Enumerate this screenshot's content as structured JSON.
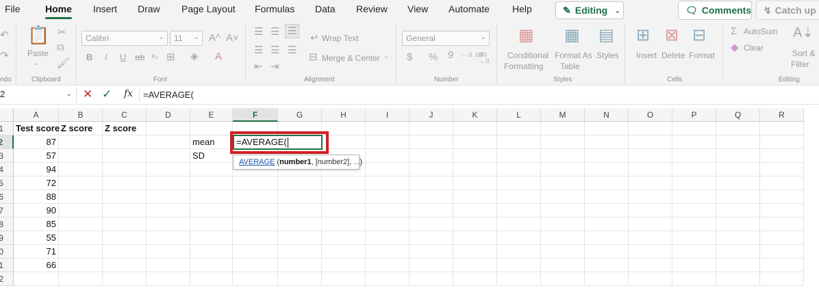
{
  "menu": {
    "tabs": [
      "File",
      "Home",
      "Insert",
      "Draw",
      "Page Layout",
      "Formulas",
      "Data",
      "Review",
      "View",
      "Automate",
      "Help"
    ],
    "active": "Home",
    "editing_label": "Editing",
    "comments_label": "Comments",
    "catchup_label": "Catch up"
  },
  "ribbon": {
    "undo_group": "ndo",
    "clipboard": {
      "paste": "Paste",
      "group": "Clipboard"
    },
    "font": {
      "name": "Calibri",
      "size": "11",
      "group": "Font",
      "grow": "A^",
      "shrink": "A˅",
      "bold": "B",
      "italic": "I",
      "underline": "U",
      "strike": "ab"
    },
    "alignment": {
      "wrap": "Wrap Text",
      "merge": "Merge & Center",
      "group": "Alignment"
    },
    "number": {
      "format": "General",
      "currency": "$",
      "percent": "%",
      "comma": "9",
      "inc_decimal": "←.0 .00",
      "dec_decimal": ".00 →.0",
      "group": "Number"
    },
    "styles": {
      "conditional_1": "Conditional",
      "conditional_2": "Formatting",
      "format_as_1": "Format As",
      "format_as_2": "Table",
      "styles": "Styles",
      "group": "Styles"
    },
    "cells": {
      "insert": "Insert",
      "delete": "Delete",
      "format": "Format",
      "group": "Cells"
    },
    "editing": {
      "autosum": "AutoSum",
      "clear": "Clear",
      "sort_1": "Sort &",
      "sort_2": "Filter",
      "group": "Editing"
    }
  },
  "formula_bar": {
    "name_box": "2",
    "cancel": "✕",
    "enter": "✓",
    "fx": "fx",
    "formula": "=AVERAGE("
  },
  "grid": {
    "columns": [
      "A",
      "B",
      "C",
      "D",
      "E",
      "F",
      "G",
      "H",
      "I",
      "J",
      "K",
      "L",
      "M",
      "N",
      "O",
      "P",
      "Q",
      "R"
    ],
    "row_labels": [
      "1",
      "2",
      "3",
      "4",
      "5",
      "6",
      "7",
      "8",
      "9",
      "0",
      "1",
      "2"
    ],
    "headers": {
      "a1": "Test score",
      "b1": "Z score",
      "c1": "Z score"
    },
    "scores": [
      "87",
      "57",
      "94",
      "72",
      "88",
      "90",
      "85",
      "55",
      "71",
      "66"
    ],
    "labels": {
      "e2": "mean",
      "e3": "SD"
    },
    "active_cell_text": "=AVERAGE(",
    "tooltip": {
      "fn": "AVERAGE",
      "open": " (",
      "arg1": "number1",
      "rest": ", [number2], ...)"
    }
  },
  "colors": {
    "accent": "#1e7145",
    "highlight": "#d11f27",
    "cancel": "#c4262e"
  }
}
